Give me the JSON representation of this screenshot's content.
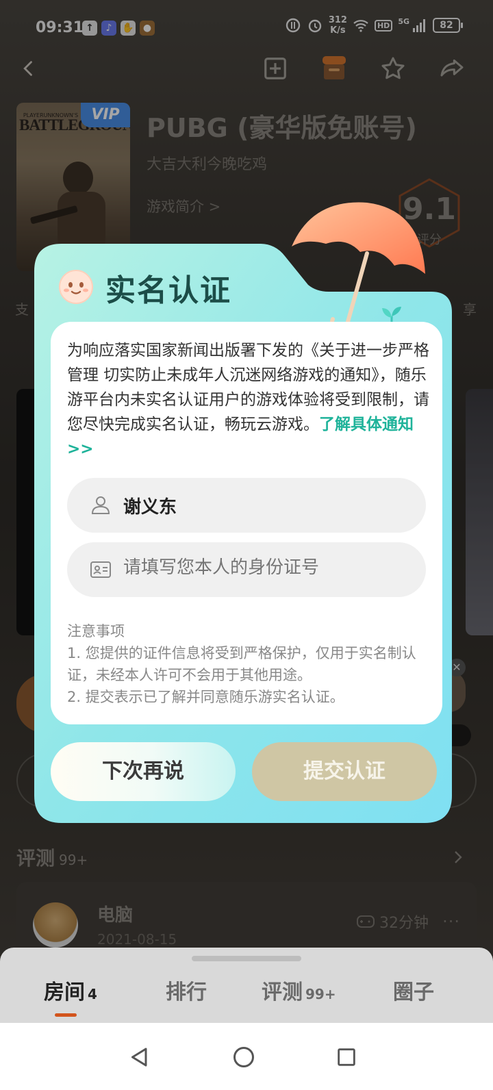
{
  "status_bar": {
    "time": "09:31",
    "net_speed_value": "312",
    "net_speed_unit": "K/s",
    "hd": "HD",
    "network": "5G",
    "battery": "82"
  },
  "nav": {
    "icons": [
      "back-icon",
      "add-box-icon",
      "shop-icon",
      "star-icon",
      "share-icon"
    ]
  },
  "game": {
    "cover_title": "BATTLEGROUNDS",
    "cover_sub": "PLAYERUNKNOWN'S",
    "vip": "VIP",
    "title": "PUBG (豪华版免账号)",
    "subtitle": "大吉大利今晚吃鸡",
    "intro": "游戏简介 >",
    "rating": "9.1",
    "rating_label": "评分",
    "left_cut": "支",
    "right_cut": "享"
  },
  "dialog": {
    "title": "实名认证",
    "notice": "为响应落实国家新闻出版署下发的《关于进一步严格管理 切实防止未成年人沉迷网络游戏的通知》，随乐游平台内未实名认证用户的游戏体验将受到限制，请您尽快完成实名认证，畅玩云游戏。",
    "notice_link": "了解具体通知>>",
    "name_value": "谢义东",
    "id_placeholder": "请填写您本人的身份证号",
    "tips_title": "注意事项",
    "tip_1": "1. 您提供的证件信息将受到严格保护，仅用于实名制认证，未经本人许可不会用于其他用途。",
    "tip_2": "2. 提交表示已了解并同意随乐游实名认证。",
    "later_label": "下次再说",
    "submit_label": "提交认证"
  },
  "reviews": {
    "header": "评测",
    "count": "99+",
    "item": {
      "name": "电脑",
      "date": "2021-08-15",
      "playtime": "32分钟",
      "more": "···"
    }
  },
  "tabs": [
    {
      "label": "房间",
      "badge": "4"
    },
    {
      "label": "排行",
      "badge": ""
    },
    {
      "label": "评测",
      "badge": "99+"
    },
    {
      "label": "圈子",
      "badge": ""
    }
  ],
  "bg_close": "✕",
  "colors": {
    "accent_teal": "#1fb39a",
    "tab_active_underline": "#d2541c",
    "submit_disabled": "#cfc6a4"
  }
}
